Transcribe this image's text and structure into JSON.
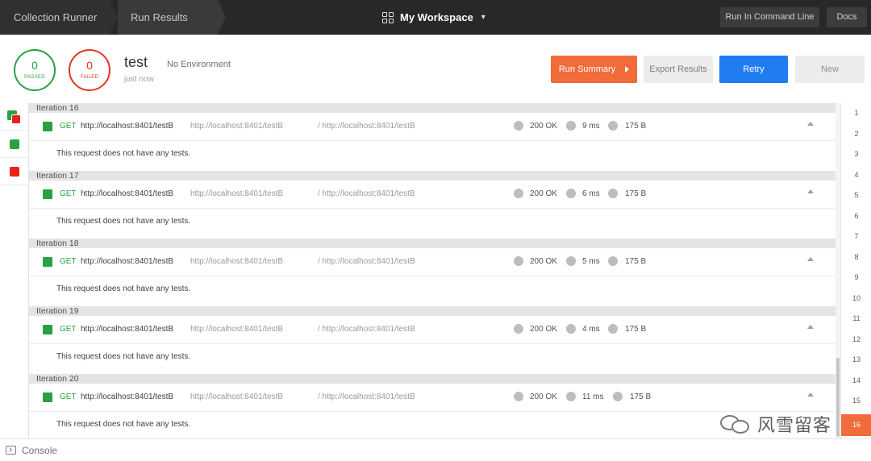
{
  "topbar": {
    "breadcrumb_1": "Collection Runner",
    "breadcrumb_2": "Run Results",
    "workspace": "My Workspace",
    "cli_button": "Run In Command Line",
    "docs_button": "Docs"
  },
  "summary": {
    "passed_count": "0",
    "passed_label": "PASSED",
    "failed_count": "0",
    "failed_label": "FAILED",
    "run_name": "test",
    "run_time": "just now",
    "environment": "No Environment",
    "run_summary_button": "Run Summary",
    "export_button": "Export Results",
    "retry_button": "Retry",
    "new_button": "New"
  },
  "iterations": [
    {
      "title": "Iteration 16",
      "method": "GET",
      "url": "http://localhost:8401/testB",
      "url2": "http://localhost:8401/testB",
      "url3": "/ http://localhost:8401/testB",
      "code": "200 OK",
      "time": "9 ms",
      "size": "175 B",
      "message": "This request does not have any tests."
    },
    {
      "title": "Iteration 17",
      "method": "GET",
      "url": "http://localhost:8401/testB",
      "url2": "http://localhost:8401/testB",
      "url3": "/ http://localhost:8401/testB",
      "code": "200 OK",
      "time": "6 ms",
      "size": "175 B",
      "message": "This request does not have any tests."
    },
    {
      "title": "Iteration 18",
      "method": "GET",
      "url": "http://localhost:8401/testB",
      "url2": "http://localhost:8401/testB",
      "url3": "/ http://localhost:8401/testB",
      "code": "200 OK",
      "time": "5 ms",
      "size": "175 B",
      "message": "This request does not have any tests."
    },
    {
      "title": "Iteration 19",
      "method": "GET",
      "url": "http://localhost:8401/testB",
      "url2": "http://localhost:8401/testB",
      "url3": "/ http://localhost:8401/testB",
      "code": "200 OK",
      "time": "4 ms",
      "size": "175 B",
      "message": "This request does not have any tests."
    },
    {
      "title": "Iteration 20",
      "method": "GET",
      "url": "http://localhost:8401/testB",
      "url2": "http://localhost:8401/testB",
      "url3": "/ http://localhost:8401/testB",
      "code": "200 OK",
      "time": "11 ms",
      "size": "175 B",
      "message": "This request does not have any tests."
    }
  ],
  "iteration_numbers": [
    "1",
    "2",
    "3",
    "4",
    "5",
    "6",
    "7",
    "8",
    "9",
    "10",
    "11",
    "12",
    "13",
    "14",
    "15",
    "16"
  ],
  "active_iteration": "16",
  "console_label": "Console",
  "watermark_text": "风雪留客",
  "colors": {
    "pass": "#27a144",
    "fail": "#e8331c",
    "accent_orange": "#f26b3a",
    "retry_blue": "#1f7cf1",
    "topbar": "#282828"
  },
  "icons": [
    "grid-icon",
    "chevron-down-icon",
    "play-triangle-icon",
    "collapse-up-icon",
    "console-icon",
    "wechat-logo"
  ]
}
